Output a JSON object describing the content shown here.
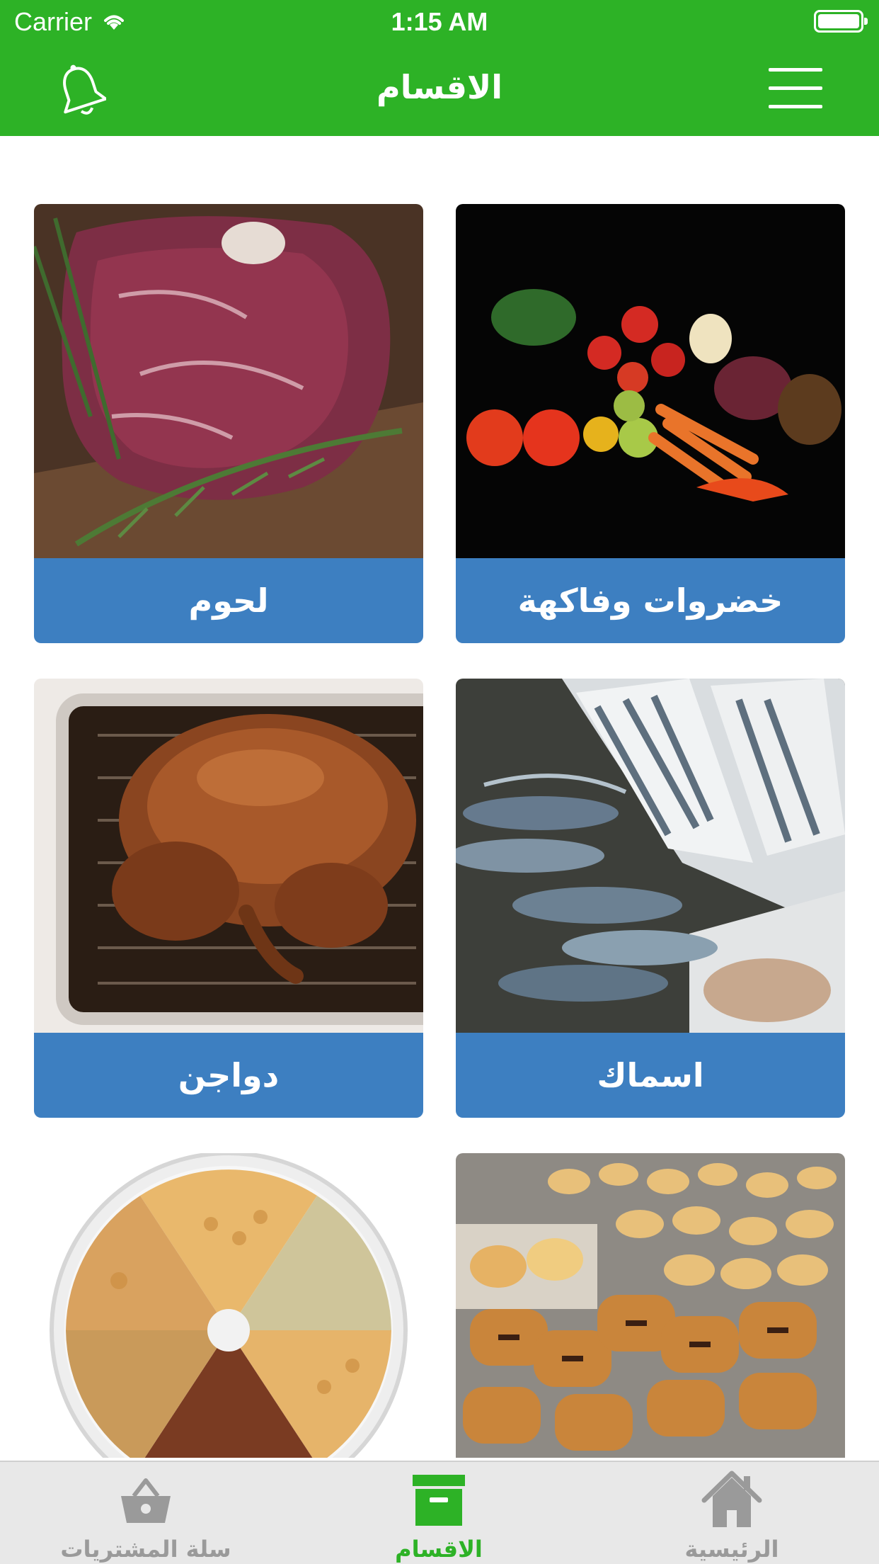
{
  "status_bar": {
    "carrier": "Carrier",
    "time": "1:15 AM"
  },
  "nav": {
    "title": "الاقسام",
    "left_icon": "bell-icon",
    "right_icon": "hamburger-menu-icon"
  },
  "categories": [
    {
      "label": "لحوم",
      "image": "raw-steak-with-rosemary"
    },
    {
      "label": "خضروات وفاكهة",
      "image": "vegetables-assortment-on-black"
    },
    {
      "label": "دواجن",
      "image": "roast-turkey-in-pan"
    },
    {
      "label": "اسماك",
      "image": "fresh-fish-in-crates"
    },
    {
      "label": "",
      "image": "mixed-nuts-platter"
    },
    {
      "label": "",
      "image": "pastries-tray"
    }
  ],
  "tabbar": {
    "items": [
      {
        "label": "سلة المشتريات",
        "icon": "shopping-basket-icon",
        "active": false
      },
      {
        "label": "الاقسام",
        "icon": "archive-box-icon",
        "active": true
      },
      {
        "label": "الرئيسية",
        "icon": "home-icon",
        "active": false
      }
    ]
  },
  "colors": {
    "primary_green": "#2db226",
    "card_blue": "#3d7fc1",
    "tab_inactive": "#9a9a9a"
  }
}
